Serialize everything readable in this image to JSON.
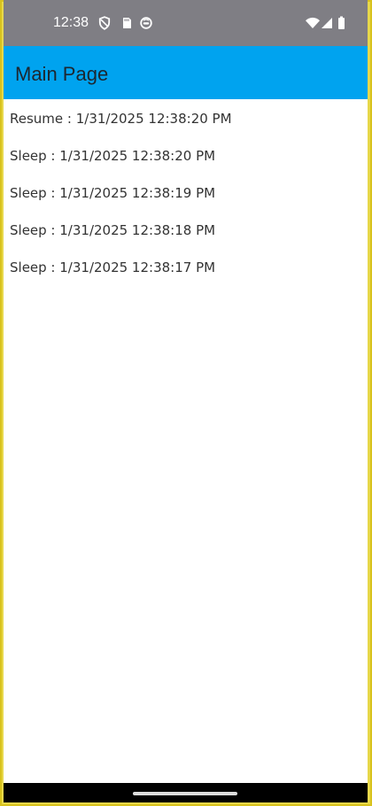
{
  "status_bar": {
    "time": "12:38",
    "left_icons": [
      "shield-icon",
      "sd-card-icon",
      "sync-status-icon"
    ],
    "right_icons": [
      "wifi-icon",
      "cellular-signal-icon",
      "battery-icon"
    ],
    "background_color": "#7f7e84"
  },
  "app_bar": {
    "title": "Main Page",
    "background_color": "#00a3ef"
  },
  "log_entries": [
    "Resume : 1/31/2025 12:38:20 PM",
    "Sleep : 1/31/2025 12:38:20 PM",
    "Sleep : 1/31/2025 12:38:19 PM",
    "Sleep : 1/31/2025 12:38:18 PM",
    "Sleep : 1/31/2025 12:38:17 PM"
  ],
  "navigation_bar": {
    "home_indicator": "home-indicator"
  }
}
